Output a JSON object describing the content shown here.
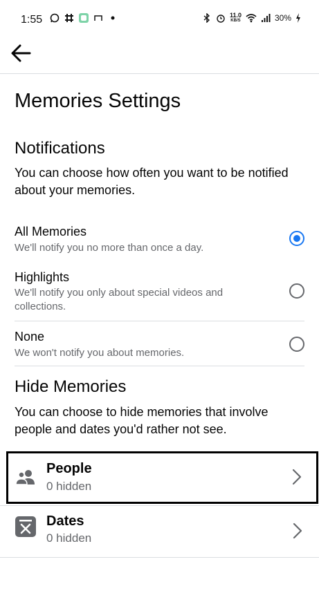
{
  "status_bar": {
    "time": "1:55",
    "net_speed_value": "11.0",
    "net_speed_unit": "KB/S",
    "battery": "30%",
    "icons": [
      "whatsapp-icon",
      "slack-icon",
      "app-icon",
      "cast-icon",
      "dot-icon",
      "bluetooth-icon",
      "alarm-icon",
      "wifi-icon",
      "signal-icon",
      "battery-charging-icon"
    ]
  },
  "header": {
    "back_icon": "arrow-left-icon"
  },
  "page": {
    "title": "Memories Settings"
  },
  "notifications": {
    "title": "Notifications",
    "description": "You can choose how often you want to be notified about your memories.",
    "options": [
      {
        "label": "All Memories",
        "sub": "We'll notify you no more than once a day.",
        "selected": true
      },
      {
        "label": "Highlights",
        "sub": "We'll notify you only about special videos and collections.",
        "selected": false
      },
      {
        "label": "None",
        "sub": "We won't notify you about memories.",
        "selected": false
      }
    ]
  },
  "hide_memories": {
    "title": "Hide Memories",
    "description": "You can choose to hide memories that involve people and dates you'd rather not see.",
    "items": [
      {
        "label": "People",
        "sub": "0 hidden",
        "icon": "people-icon"
      },
      {
        "label": "Dates",
        "sub": "0 hidden",
        "icon": "calendar-x-icon"
      }
    ]
  },
  "colors": {
    "accent": "#1877f2",
    "secondary_text": "#65676b",
    "divider": "#dadde1"
  }
}
